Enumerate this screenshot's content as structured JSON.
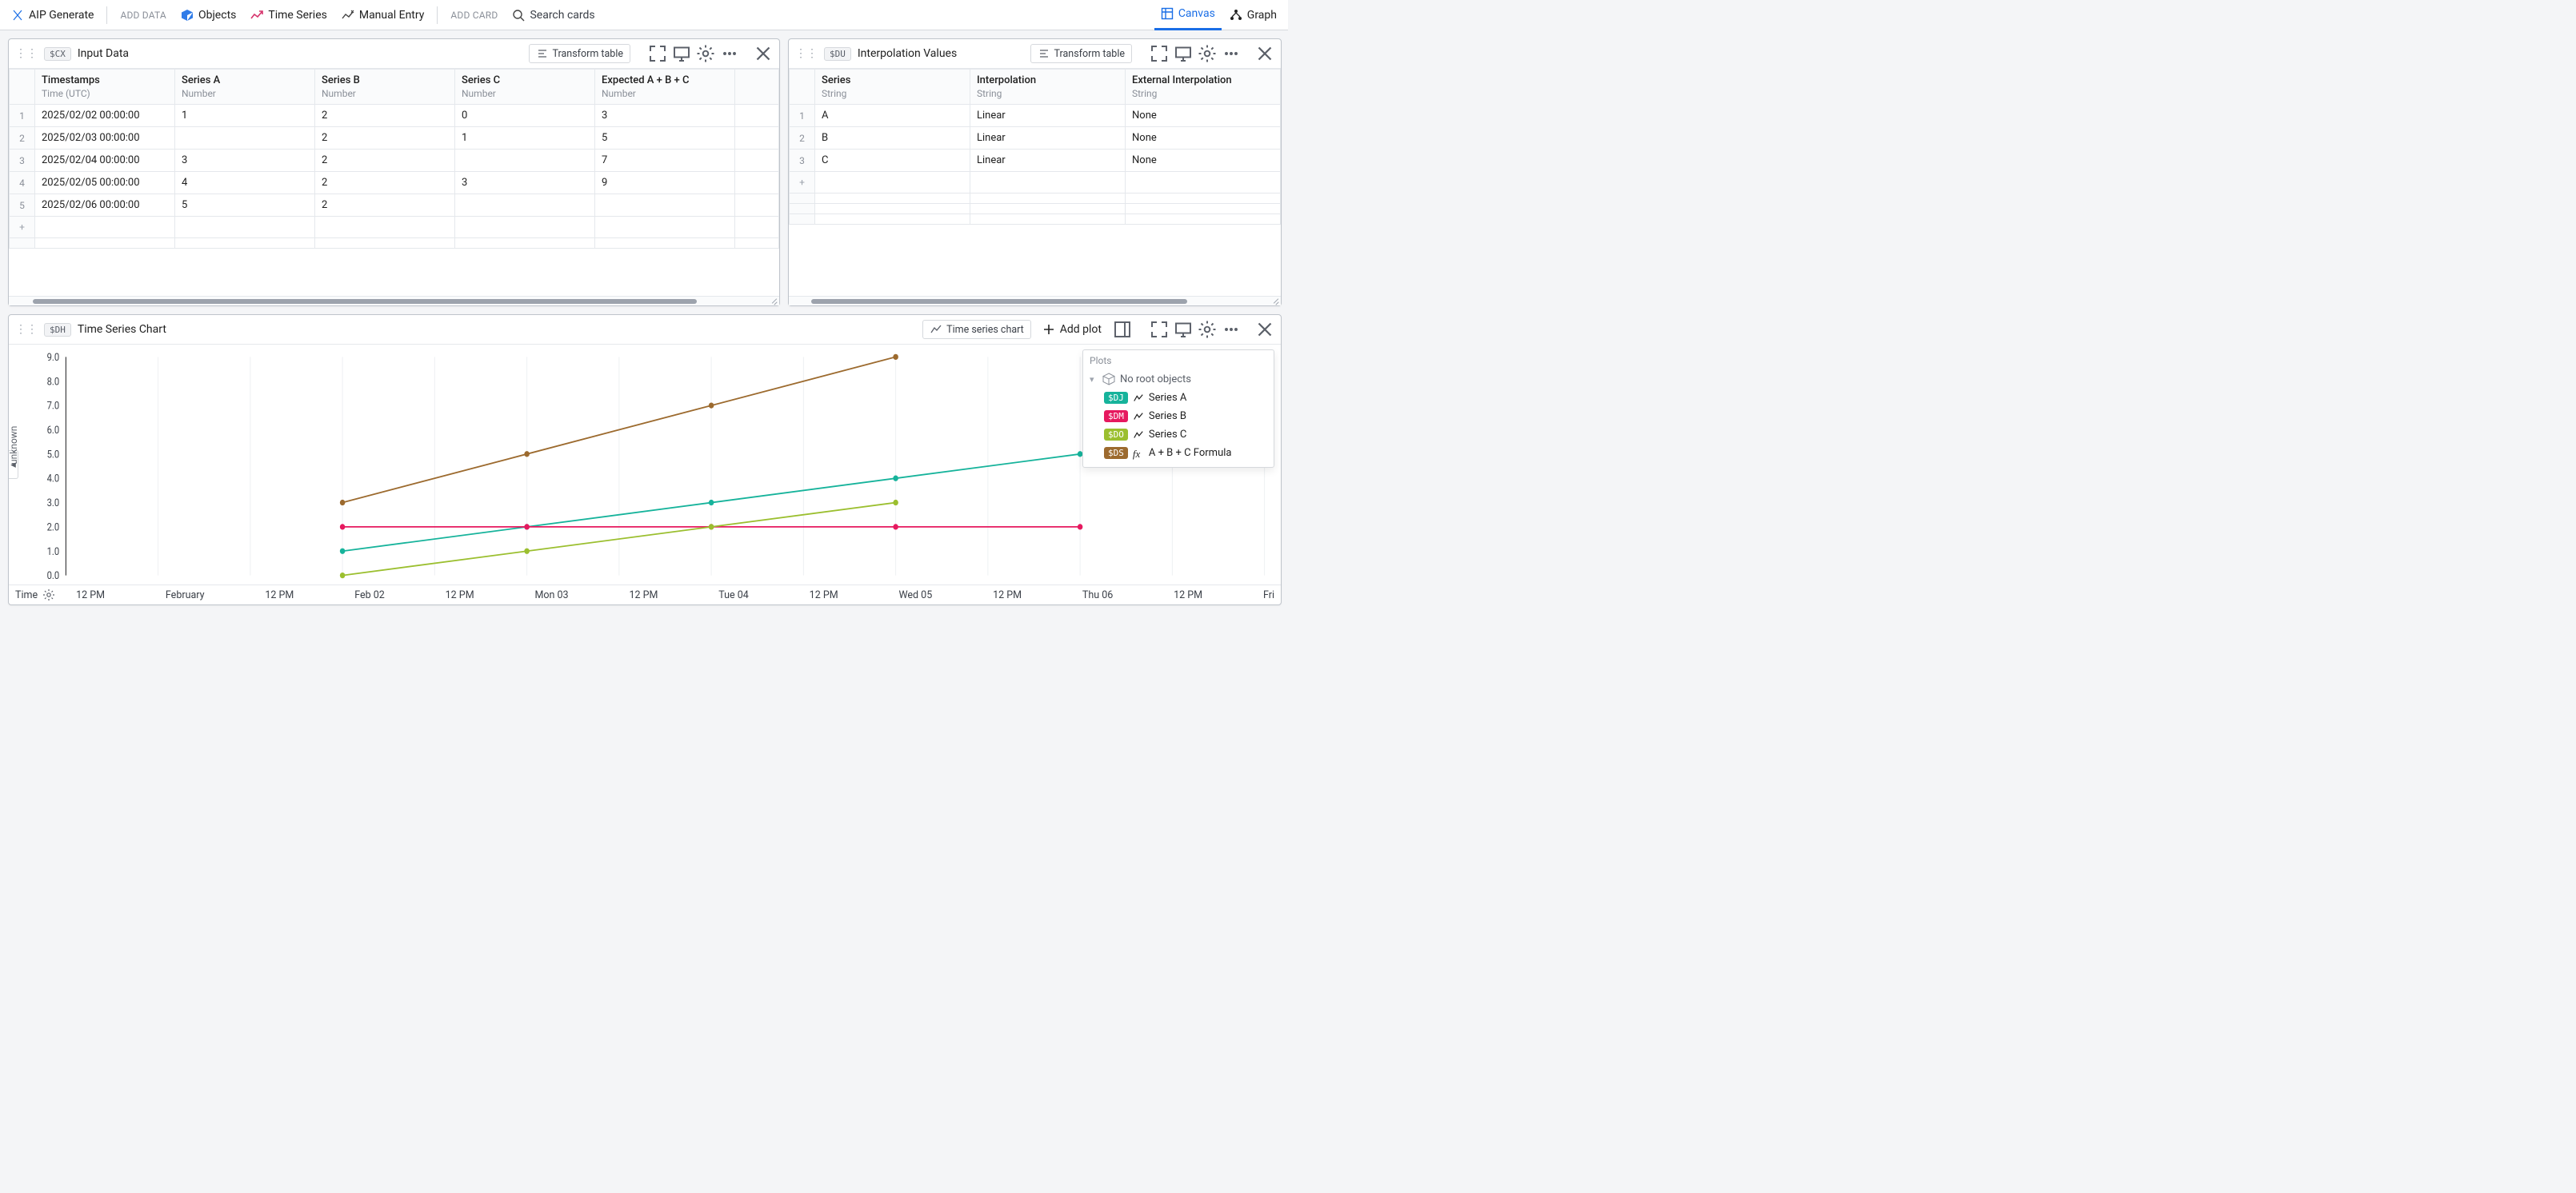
{
  "toolbar": {
    "aip_generate": "AIP Generate",
    "add_data": "ADD DATA",
    "objects": "Objects",
    "time_series": "Time Series",
    "manual_entry": "Manual Entry",
    "add_card": "ADD CARD",
    "search_placeholder": "Search cards",
    "canvas": "Canvas",
    "graph": "Graph"
  },
  "card_input": {
    "chip": "$CX",
    "title": "Input Data",
    "transform_label": "Transform table",
    "columns": [
      {
        "label": "Timestamps",
        "sub": "Time (UTC)"
      },
      {
        "label": "Series A",
        "sub": "Number"
      },
      {
        "label": "Series B",
        "sub": "Number"
      },
      {
        "label": "Series C",
        "sub": "Number"
      },
      {
        "label": "Expected A + B + C",
        "sub": "Number"
      }
    ],
    "rows": [
      [
        "2025/02/02 00:00:00",
        "1",
        "2",
        "0",
        "3"
      ],
      [
        "2025/02/03 00:00:00",
        "",
        "2",
        "1",
        "5"
      ],
      [
        "2025/02/04 00:00:00",
        "3",
        "2",
        "",
        "7"
      ],
      [
        "2025/02/05 00:00:00",
        "4",
        "2",
        "3",
        "9"
      ],
      [
        "2025/02/06 00:00:00",
        "5",
        "2",
        "",
        ""
      ]
    ]
  },
  "card_interp": {
    "chip": "$DU",
    "title": "Interpolation Values",
    "transform_label": "Transform table",
    "columns": [
      {
        "label": "Series",
        "sub": "String"
      },
      {
        "label": "Interpolation",
        "sub": "String"
      },
      {
        "label": "External Interpolation",
        "sub": "String"
      }
    ],
    "rows": [
      [
        "A",
        "Linear",
        "None"
      ],
      [
        "B",
        "Linear",
        "None"
      ],
      [
        "C",
        "Linear",
        "None"
      ]
    ]
  },
  "card_chart": {
    "chip": "$DH",
    "title": "Time Series Chart",
    "chart_btn_label": "Time series chart",
    "add_plot_label": "Add plot",
    "time_label": "Time",
    "y_label": "unknown",
    "legend_header": "Plots",
    "legend_group": "No root objects",
    "legend": [
      {
        "chip": "$DJ",
        "color": "#16b39b",
        "label": "Series A",
        "kind": "line"
      },
      {
        "chip": "$DM",
        "color": "#e6195f",
        "label": "Series B",
        "kind": "line"
      },
      {
        "chip": "$DO",
        "color": "#9bbf2f",
        "label": "Series C",
        "kind": "line"
      },
      {
        "chip": "$DS",
        "color": "#9c6a2e",
        "label": "A + B + C Formula",
        "kind": "fx"
      }
    ]
  },
  "chart_data": {
    "type": "line",
    "xlabel": "Time",
    "ylabel": "unknown",
    "ylim": [
      0,
      9
    ],
    "x_ticks": [
      "12 PM",
      "February",
      "12 PM",
      "Feb 02",
      "12 PM",
      "Mon 03",
      "12 PM",
      "Tue 04",
      "12 PM",
      "Wed 05",
      "12 PM",
      "Thu 06",
      "12 PM",
      "Fri"
    ],
    "y_ticks": [
      0,
      1,
      2,
      3,
      4,
      5,
      6,
      7,
      8,
      9
    ],
    "x_days": [
      "Feb 02",
      "Mon 03",
      "Tue 04",
      "Wed 05",
      "Thu 06"
    ],
    "series": [
      {
        "name": "Series A",
        "color": "#16b39b",
        "values": [
          1,
          2,
          3,
          4,
          5
        ]
      },
      {
        "name": "Series B",
        "color": "#e6195f",
        "values": [
          2,
          2,
          2,
          2,
          2
        ]
      },
      {
        "name": "Series C",
        "color": "#9bbf2f",
        "values": [
          0,
          1,
          2,
          3,
          null
        ]
      },
      {
        "name": "A + B + C Formula",
        "color": "#9c6a2e",
        "values": [
          3,
          5,
          7,
          9,
          null
        ]
      }
    ]
  }
}
